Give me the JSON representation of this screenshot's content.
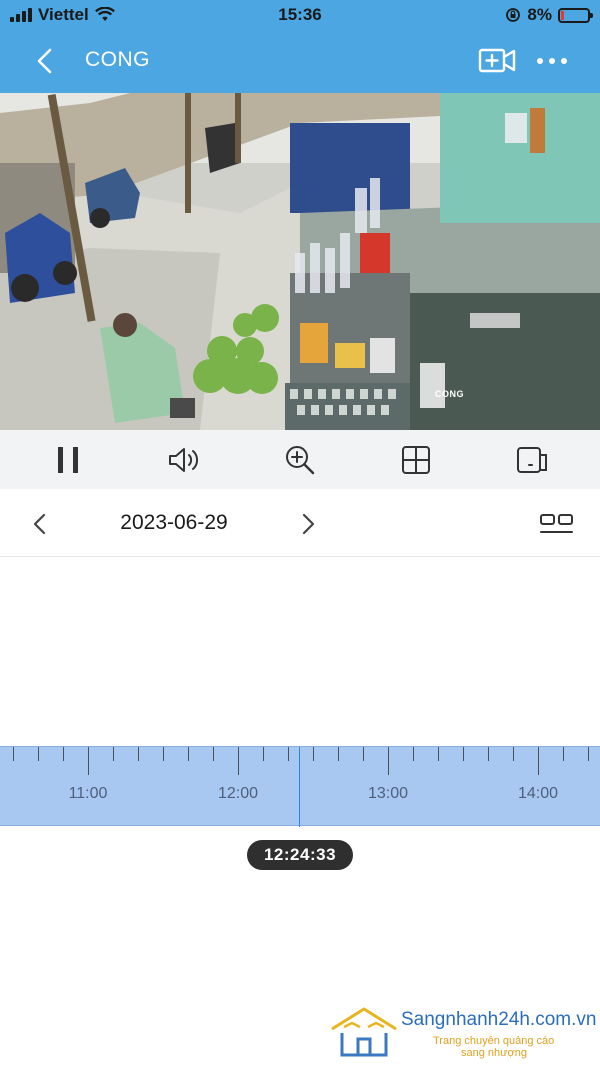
{
  "status_bar": {
    "carrier": "Viettel",
    "time": "15:36",
    "battery": "8%"
  },
  "header": {
    "title": "CONG"
  },
  "camera": {
    "overlay_label": "CONG"
  },
  "playback": {
    "date": "2023-06-29",
    "current_time": "12:24:33"
  },
  "timeline": {
    "labels": [
      "11:00",
      "12:00",
      "13:00",
      "14:00"
    ],
    "cursor_time": "12:24:33"
  },
  "icons": {
    "back": "chevron-left-icon",
    "record": "video-plus-icon",
    "more": "more-dots-icon",
    "pause": "pause-icon",
    "volume": "speaker-icon",
    "zoom": "zoom-in-icon",
    "grid": "grid-icon",
    "device": "device-switch-icon",
    "date_prev": "chevron-left-icon",
    "date_next": "chevron-right-icon",
    "view_mode": "view-mode-icon"
  },
  "colors": {
    "header": "#4ba6e2",
    "timeline": "#a8c8f2",
    "cursor": "#2d86d8",
    "pill": "#2f2f2f"
  },
  "watermark": {
    "main": "Sangnhanh24h.com.vn",
    "sub1": "Trang chuyên quảng cáo",
    "sub2": "sang nhượng"
  }
}
